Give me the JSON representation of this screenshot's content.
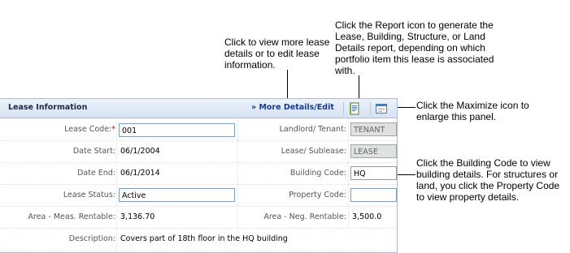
{
  "callouts": {
    "report": "Click the Report icon to generate the Lease, Building, Structure, or Land Details report, depending on which portfolio item this lease is associated with.",
    "more_details": "Click to view more lease details or to edit lease information.",
    "maximize": "Click the Maximize icon to enlarge this panel.",
    "building_code": "Click  the Building Code to view building details. For structures or land, you click the Property Code to view property details."
  },
  "panel": {
    "title": "Lease Information",
    "more_link": "» More Details/Edit",
    "icons": [
      "report-icon",
      "maximize-icon"
    ]
  },
  "fields": {
    "lease_code": {
      "label": "Lease Code:",
      "required": "*",
      "value": "001"
    },
    "landlord_tenant": {
      "label": "Landlord/ Tenant:",
      "value": "TENANT"
    },
    "date_start": {
      "label": "Date Start:",
      "value": "06/1/2004"
    },
    "lease_sublease": {
      "label": "Lease/ Sublease:",
      "value": "LEASE"
    },
    "date_end": {
      "label": "Date End:",
      "value": "06/1/2014"
    },
    "building_code": {
      "label": "Building Code:",
      "value": "HQ"
    },
    "lease_status": {
      "label": "Lease Status:",
      "value": "Active"
    },
    "property_code": {
      "label": "Property Code:",
      "value": ""
    },
    "area_meas": {
      "label": "Area - Meas. Rentable:",
      "value": "3,136.70"
    },
    "area_neg": {
      "label": "Area - Neg. Rentable:",
      "value": "3,500.0"
    },
    "description": {
      "label": "Description:",
      "value": "Covers part of 18th floor in the HQ building"
    }
  },
  "colors": {
    "header_bg": "#d6e3f4",
    "link": "#1a3a8a",
    "border": "#a9bedb",
    "required": "#cc0000"
  }
}
